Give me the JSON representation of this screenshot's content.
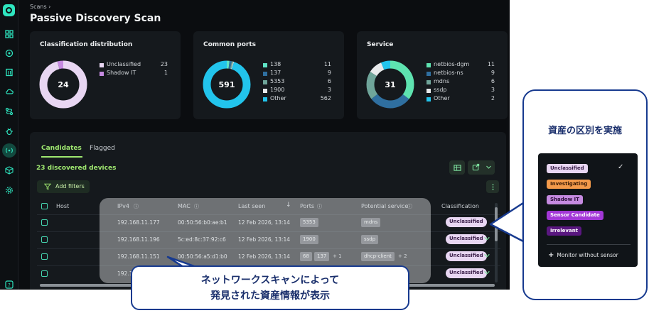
{
  "breadcrumb": "Scans",
  "page_title": "Passive Discovery Scan",
  "cards": {
    "classification": {
      "title": "Classification distribution",
      "total": "24",
      "items": [
        {
          "label": "Unclassified",
          "value": "23",
          "color": "#e8d6f2"
        },
        {
          "label": "Shadow IT",
          "value": "1",
          "color": "#c58ae0"
        }
      ]
    },
    "ports": {
      "title": "Common ports",
      "total": "591",
      "items": [
        {
          "label": "138",
          "value": "11",
          "color": "#5ee3c6"
        },
        {
          "label": "137",
          "value": "9",
          "color": "#2f6fa0"
        },
        {
          "label": "5353",
          "value": "6",
          "color": "#6fa59a"
        },
        {
          "label": "1900",
          "value": "3",
          "color": "#e8eaec"
        },
        {
          "label": "Other",
          "value": "562",
          "color": "#22c4ec"
        }
      ]
    },
    "service": {
      "title": "Service",
      "total": "31",
      "items": [
        {
          "label": "netbios-dgm",
          "value": "11",
          "color": "#5ee3b0"
        },
        {
          "label": "netbios-ns",
          "value": "9",
          "color": "#2f6fa0"
        },
        {
          "label": "mdns",
          "value": "6",
          "color": "#6fa59a"
        },
        {
          "label": "ssdp",
          "value": "3",
          "color": "#e8eaec"
        },
        {
          "label": "Other",
          "value": "2",
          "color": "#22c4ec"
        }
      ]
    }
  },
  "tabs": {
    "candidates": "Candidates",
    "flagged": "Flagged"
  },
  "discovered": "23 discovered devices",
  "add_filters": "Add filters",
  "columns": {
    "host": "Host",
    "ipv4": "IPv4",
    "mac": "MAC",
    "last_seen": "Last seen",
    "ports": "Ports",
    "service": "Potential service",
    "classification": "Classification"
  },
  "rows": [
    {
      "ip": "192.168.11.177",
      "mac": "00:50:56:b0:ae:b1",
      "seen": "12 Feb 2026, 13:14",
      "ports": [
        "5353"
      ],
      "ports_more": "",
      "service": "mdns",
      "service_more": "",
      "class": "Unclassified"
    },
    {
      "ip": "192.168.11.196",
      "mac": "5c:ed:8c:37:92:c6",
      "seen": "12 Feb 2026, 13:14",
      "ports": [
        "1900"
      ],
      "ports_more": "",
      "service": "ssdp",
      "service_more": "",
      "class": "Unclassified"
    },
    {
      "ip": "192.168.11.151",
      "mac": "00:50:56:a5:d1:b0",
      "seen": "12 Feb 2026, 13:14",
      "ports": [
        "68",
        "137"
      ],
      "ports_more": "+ 1",
      "service": "dhcp-client",
      "service_more": "+ 2",
      "class": "Unclassified"
    },
    {
      "ip": "192.1",
      "mac": "",
      "seen": "",
      "ports": [],
      "ports_more": "",
      "service": "",
      "service_more": "",
      "class": "Unclassified"
    }
  ],
  "callout_bottom": {
    "line1": "ネットワークスキャンによって",
    "line2": "発見された資産情報が表示"
  },
  "callout_right": {
    "title": "資産の区別を実施"
  },
  "dropdown": {
    "options": [
      {
        "label": "Unclassified",
        "bg": "#e8d6f2",
        "fg": "#3b1f4a"
      },
      {
        "label": "Investigating",
        "bg": "#f39a4a",
        "fg": "#3a1a05"
      },
      {
        "label": "Shadow IT",
        "bg": "#c58ae0",
        "fg": "#2c0f3a"
      },
      {
        "label": "Sensor Candidate",
        "bg": "#a237d6",
        "fg": "#ffffff"
      },
      {
        "label": "Irrelevant",
        "bg": "#5a1780",
        "fg": "#ffffff"
      }
    ],
    "checked": "✓",
    "monitor_plus": "+",
    "monitor": "Monitor without sensor"
  },
  "colors": {
    "accent": "#9fe870",
    "teal": "#2ee6c0",
    "callout_border": "#173a8f"
  }
}
